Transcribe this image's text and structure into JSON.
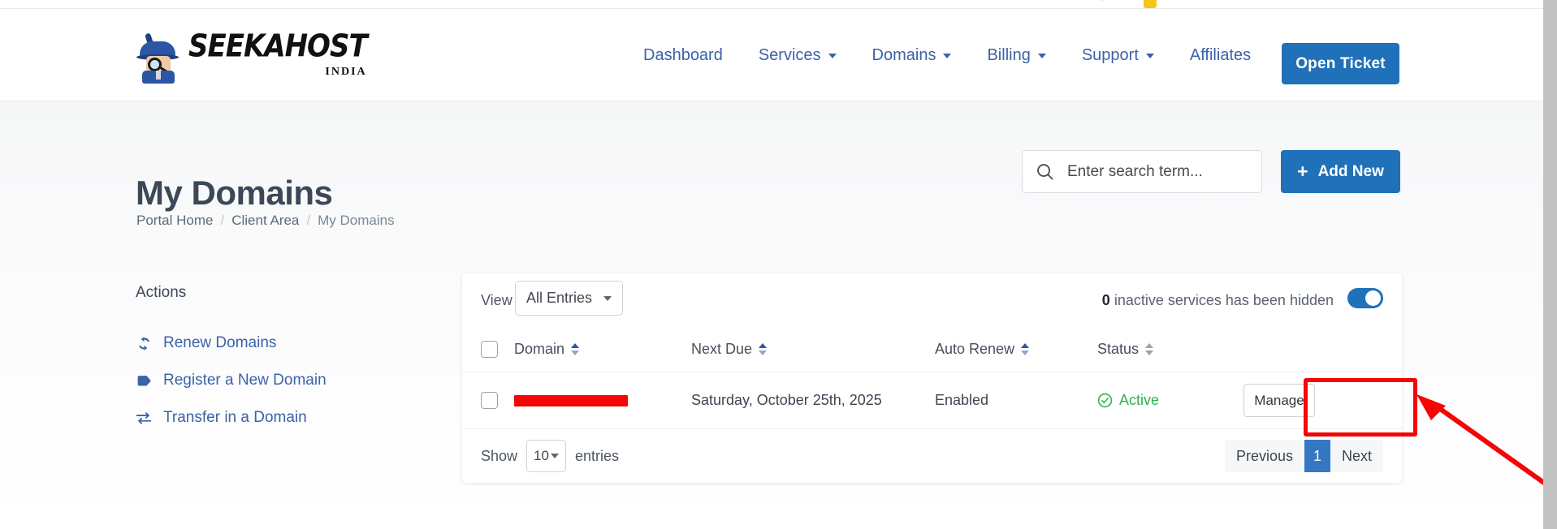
{
  "brand": {
    "logo_word": "SEEKAHOST",
    "logo_sub": "INDIA",
    "accent_blue": "#2071b9",
    "link_blue": "#3a63a8"
  },
  "header": {
    "nav": [
      {
        "label": "Dashboard",
        "has_caret": false
      },
      {
        "label": "Services",
        "has_caret": true
      },
      {
        "label": "Domains",
        "has_caret": true
      },
      {
        "label": "Billing",
        "has_caret": true
      },
      {
        "label": "Support",
        "has_caret": true
      },
      {
        "label": "Affiliates",
        "has_caret": false
      }
    ],
    "open_ticket_label": "Open Ticket"
  },
  "page": {
    "title": "My Domains",
    "breadcrumb": {
      "home": "Portal Home",
      "sep1": "/",
      "client_area": "Client Area",
      "sep2": "/",
      "current": "My Domains"
    }
  },
  "search": {
    "placeholder": "Enter search term...",
    "value": "",
    "icon": "search-icon"
  },
  "add_new": {
    "label": "Add New",
    "icon": "plus-icon"
  },
  "sidebar": {
    "heading": "Actions",
    "items": [
      {
        "label": "Renew Domains",
        "icon": "sync-icon"
      },
      {
        "label": "Register a New Domain",
        "icon": "tag-icon"
      },
      {
        "label": "Transfer in a Domain",
        "icon": "exchange-arrows-icon"
      }
    ]
  },
  "card": {
    "view_label": "View",
    "view_value": "All Entries",
    "hidden_count": "0",
    "hidden_text": "inactive services has been hidden",
    "toggle_on": true,
    "columns": [
      {
        "label": "Domain",
        "sorted": true
      },
      {
        "label": "Next Due",
        "sorted": true
      },
      {
        "label": "Auto Renew",
        "sorted": true
      },
      {
        "label": "Status",
        "sorted": false
      }
    ],
    "rows": [
      {
        "domain": "",
        "domain_redacted": true,
        "next_due": "Saturday, October 25th, 2025",
        "auto_renew": "Enabled",
        "status": "Active",
        "status_color": "#2bb34b",
        "action_label": "Manage"
      }
    ],
    "footer": {
      "show_label": "Show",
      "page_length": "10",
      "entries_label": "entries",
      "previous": "Previous",
      "current_page": "1",
      "next": "Next"
    }
  },
  "annotations": {
    "highlight_target": "Manage",
    "highlight_color": "#f50505"
  }
}
